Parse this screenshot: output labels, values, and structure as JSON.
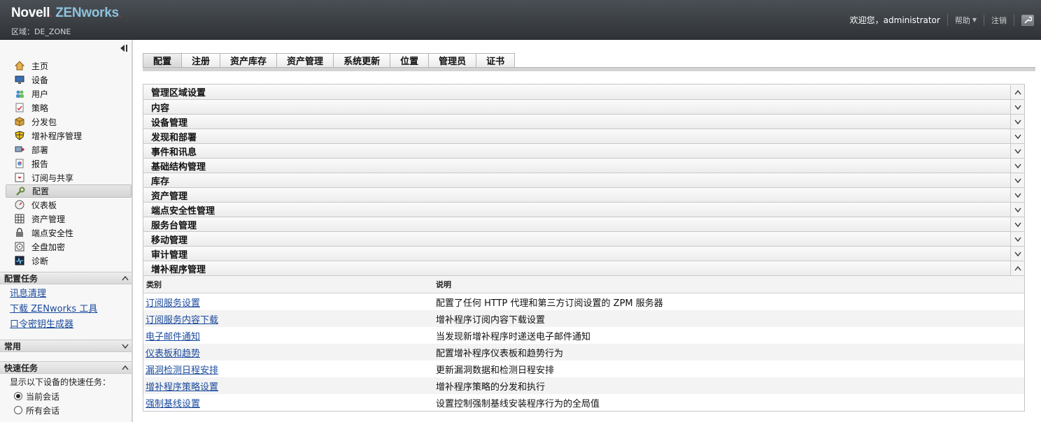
{
  "header": {
    "brand_novell": "Novell",
    "brand_dot": ".",
    "brand_zenworks": "ZENworks",
    "brand_mark": ".",
    "zone": "区域：DE_ZONE",
    "welcome": "欢迎您，administrator",
    "help": "帮助",
    "logout": "注销"
  },
  "sidebar": {
    "nav": [
      {
        "label": "主页",
        "icon": "home-icon"
      },
      {
        "label": "设备",
        "icon": "monitor-icon"
      },
      {
        "label": "用户",
        "icon": "users-icon"
      },
      {
        "label": "策略",
        "icon": "policy-icon"
      },
      {
        "label": "分发包",
        "icon": "package-icon"
      },
      {
        "label": "增补程序管理",
        "icon": "shield-icon"
      },
      {
        "label": "部署",
        "icon": "deploy-icon"
      },
      {
        "label": "报告",
        "icon": "report-icon"
      },
      {
        "label": "订阅与共享",
        "icon": "subscription-icon"
      },
      {
        "label": "配置",
        "icon": "wrench-icon"
      },
      {
        "label": "仪表板",
        "icon": "dashboard-icon"
      },
      {
        "label": "资产管理",
        "icon": "asset-icon"
      },
      {
        "label": "端点安全性",
        "icon": "endpoint-icon"
      },
      {
        "label": "全盘加密",
        "icon": "disk-icon"
      },
      {
        "label": "诊断",
        "icon": "diagnostics-icon"
      }
    ],
    "config_tasks_title": "配置任务",
    "config_tasks": [
      "讯息清理",
      "下载 ZENworks 工具",
      "口令密钥生成器"
    ],
    "common_title": "常用",
    "quick_tasks_title": "快速任务",
    "quick_tasks_prompt": "显示以下设备的快速任务：",
    "quick_options": [
      "当前会话",
      "所有会话"
    ]
  },
  "tabs": [
    "配置",
    "注册",
    "资产库存",
    "资产管理",
    "系统更新",
    "位置",
    "管理员",
    "证书"
  ],
  "sections": [
    "管理区域设置",
    "内容",
    "设备管理",
    "发现和部署",
    "事件和讯息",
    "基础结构管理",
    "库存",
    "资产管理",
    "端点安全性管理",
    "服务台管理",
    "移动管理",
    "审计管理",
    "增补程序管理"
  ],
  "table": {
    "col_category": "类别",
    "col_description": "说明",
    "rows": [
      {
        "category": "订阅服务设置",
        "description": "配置了任何 HTTP 代理和第三方订阅设置的 ZPM 服务器"
      },
      {
        "category": "订阅服务内容下载",
        "description": "增补程序订阅内容下载设置"
      },
      {
        "category": "电子邮件通知",
        "description": "当发现新增补程序时递送电子邮件通知"
      },
      {
        "category": "仪表板和趋势",
        "description": "配置增补程序仪表板和趋势行为"
      },
      {
        "category": "漏洞检测日程安排",
        "description": "更新漏洞数据和检测日程安排"
      },
      {
        "category": "增补程序策略设置",
        "description": "增补程序策略的分发和执行"
      },
      {
        "category": "强制基线设置",
        "description": "设置控制强制基线安装程序行为的全局值"
      }
    ]
  }
}
